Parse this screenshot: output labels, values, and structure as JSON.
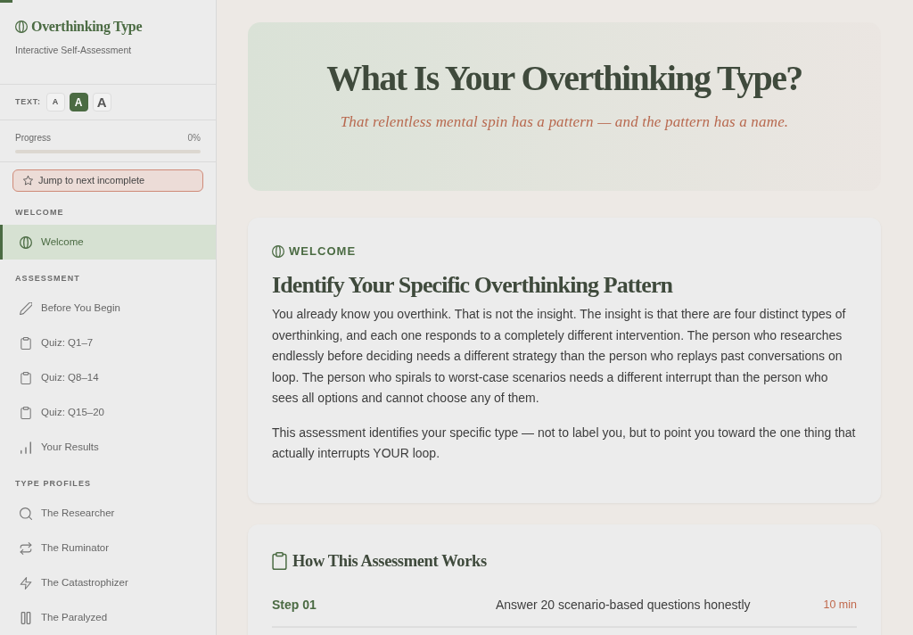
{
  "scroll_progress": {
    "level": 0.014
  },
  "sidebar": {
    "brand": {
      "title": "Overthinking Type",
      "subtitle": "Interactive Self-Assessment"
    },
    "text_size": {
      "label": "TEXT:",
      "options": [
        {
          "label": "A",
          "kind": "small",
          "selected": false
        },
        {
          "label": "A",
          "kind": "medium",
          "selected": true
        },
        {
          "label": "A",
          "kind": "large",
          "selected": false
        }
      ]
    },
    "progress": {
      "label": "Progress",
      "value": "0%",
      "level": 0
    },
    "jump_button": {
      "label": "Jump to next incomplete"
    },
    "sections": [
      {
        "heading": "WELCOME",
        "items": [
          {
            "label": "Welcome",
            "kind": "welcome",
            "selected": true
          }
        ]
      },
      {
        "heading": "ASSESSMENT",
        "items": [
          {
            "label": "Before You Begin",
            "kind": "prep",
            "selected": false
          },
          {
            "label": "Quiz: Q1–7",
            "kind": "quiz",
            "selected": false
          },
          {
            "label": "Quiz: Q8–14",
            "kind": "quiz",
            "selected": false
          },
          {
            "label": "Quiz: Q15–20",
            "kind": "quiz",
            "selected": false
          },
          {
            "label": "Your Results",
            "kind": "results",
            "selected": false
          }
        ]
      },
      {
        "heading": "TYPE PROFILES",
        "items": [
          {
            "label": "The Researcher",
            "kind": "researcher",
            "selected": false
          },
          {
            "label": "The Ruminator",
            "kind": "ruminator",
            "selected": false
          },
          {
            "label": "The Catastrophizer",
            "kind": "catastrophizer",
            "selected": false
          },
          {
            "label": "The Paralyzed",
            "kind": "paralyzed",
            "selected": false
          }
        ]
      }
    ]
  },
  "hero": {
    "title": "What Is Your Overthinking Type?",
    "subtitle": "That relentless mental spin has a pattern — and the pattern has a name."
  },
  "intro_card": {
    "eyebrow": "WELCOME",
    "heading": "Identify Your Specific Overthinking Pattern",
    "paragraphs": [
      "You already know you overthink. That is not the insight. The insight is that there are four distinct types of overthinking, and each one responds to a completely different intervention. The person who researches endlessly before deciding needs a different strategy than the person who replays past conversations on loop. The person who spirals to worst-case scenarios needs a different interrupt than the person who sees all options and cannot choose any of them.",
      "This assessment identifies your specific type — not to label you, but to point you toward the one thing that actually interrupts YOUR loop."
    ]
  },
  "steps_card": {
    "heading": "How This Assessment Works",
    "steps": [
      {
        "label": "Step 01",
        "description": "Answer 20 scenario-based questions honestly",
        "duration": "10 min"
      }
    ]
  }
}
